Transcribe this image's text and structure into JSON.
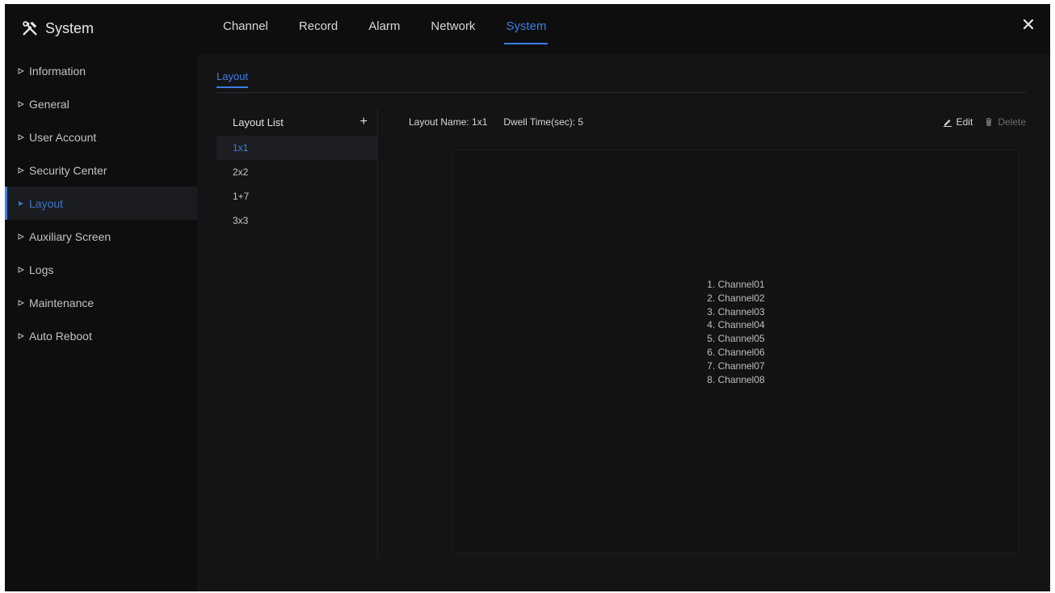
{
  "app": {
    "title": "System"
  },
  "top_nav": {
    "tabs": [
      {
        "label": "Channel"
      },
      {
        "label": "Record"
      },
      {
        "label": "Alarm"
      },
      {
        "label": "Network"
      },
      {
        "label": "System"
      }
    ],
    "active_tab": "System"
  },
  "sidebar": {
    "items": [
      {
        "label": "Information"
      },
      {
        "label": "General"
      },
      {
        "label": "User Account"
      },
      {
        "label": "Security Center"
      },
      {
        "label": "Layout"
      },
      {
        "label": "Auxiliary Screen"
      },
      {
        "label": "Logs"
      },
      {
        "label": "Maintenance"
      },
      {
        "label": "Auto Reboot"
      }
    ],
    "active_item": "Layout"
  },
  "content": {
    "sub_tab": "Layout",
    "layout_list": {
      "title": "Layout List",
      "add_icon": "+",
      "items": [
        {
          "label": "1x1"
        },
        {
          "label": "2x2"
        },
        {
          "label": "1+7"
        },
        {
          "label": "3x3"
        }
      ],
      "selected": "1x1"
    },
    "detail": {
      "name_label": "Layout Name: 1x1",
      "dwell_label": "Dwell Time(sec): 5",
      "edit_label": "Edit",
      "delete_label": "Delete"
    },
    "channels": [
      "1. Channel01",
      "2. Channel02",
      "3. Channel03",
      "4. Channel04",
      "5. Channel05",
      "6. Channel06",
      "7. Channel07",
      "8. Channel08"
    ]
  },
  "icons": {
    "app": "tools-icon",
    "close": "close-icon",
    "sidebar": "caret-right-icon",
    "add": "plus-icon",
    "edit": "pencil-icon",
    "delete": "trash-icon"
  },
  "colors": {
    "accent": "#3c7ee6",
    "background": "#0e0e0f",
    "panel": "#141416"
  }
}
